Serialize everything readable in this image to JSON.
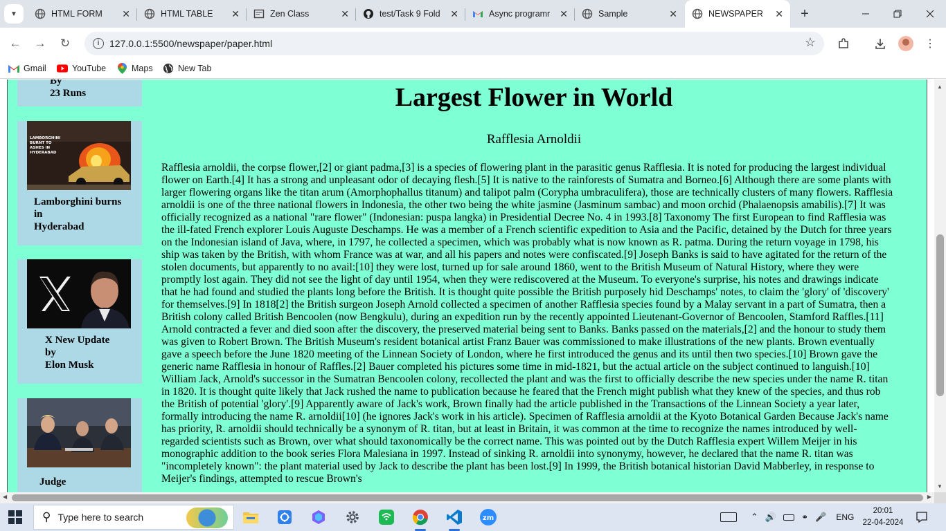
{
  "browser": {
    "tabs": [
      {
        "title": "HTML FORM",
        "icon": "globe-icon"
      },
      {
        "title": "HTML TABLE",
        "icon": "globe-icon"
      },
      {
        "title": "Zen Class",
        "icon": "zen-class-icon"
      },
      {
        "title": "test/Task 9 Fold",
        "icon": "github-icon"
      },
      {
        "title": "Async programr",
        "icon": "gmail-icon"
      },
      {
        "title": "Sample",
        "icon": "globe-icon"
      },
      {
        "title": "NEWSPAPER",
        "icon": "globe-icon",
        "active": true
      }
    ],
    "url": "127.0.0.1:5500/newspaper/paper.html",
    "bookmarks": [
      {
        "label": "Gmail",
        "icon": "gmail-icon"
      },
      {
        "label": "YouTube",
        "icon": "youtube-icon"
      },
      {
        "label": "Maps",
        "icon": "maps-icon"
      },
      {
        "label": "New Tab",
        "icon": "globe-icon"
      }
    ]
  },
  "page": {
    "sidebar": {
      "card0": {
        "line1": "By",
        "line2": "23 Runs"
      },
      "card1": {
        "line1": "Lamborghini burns",
        "line2": "in",
        "line3": "Hyderabad",
        "image_text": "LAMBORGHINI BURNT TO ASHES IN HYDERABAD"
      },
      "card2": {
        "line1": "X New Update",
        "line2": "by",
        "line3": "Elon Musk"
      },
      "card3": {
        "line1": "Judge"
      }
    },
    "headline": "Largest Flower in World",
    "subheadline": "Rafflesia Arnoldii",
    "body": "Rafflesia arnoldii, the corpse flower,[2] or giant padma,[3] is a species of flowering plant in the parasitic genus Rafflesia. It is noted for producing the largest individual flower on Earth.[4] It has a strong and unpleasant odor of decaying flesh.[5] It is native to the rainforests of Sumatra and Borneo.[6] Although there are some plants with larger flowering organs like the titan arum (Amorphophallus titanum) and talipot palm (Corypha umbraculifera), those are technically clusters of many flowers. Rafflesia arnoldii is one of the three national flowers in Indonesia, the other two being the white jasmine (Jasminum sambac) and moon orchid (Phalaenopsis amabilis).[7] It was officially recognized as a national \"rare flower\" (Indonesian: puspa langka) in Presidential Decree No. 4 in 1993.[8] Taxonomy The first European to find Rafflesia was the ill-fated French explorer Louis Auguste Deschamps. He was a member of a French scientific expedition to Asia and the Pacific, detained by the Dutch for three years on the Indonesian island of Java, where, in 1797, he collected a specimen, which was probably what is now known as R. patma. During the return voyage in 1798, his ship was taken by the British, with whom France was at war, and all his papers and notes were confiscated.[9] Joseph Banks is said to have agitated for the return of the stolen documents, but apparently to no avail:[10] they were lost, turned up for sale around 1860, went to the British Museum of Natural History, where they were promptly lost again. They did not see the light of day until 1954, when they were rediscovered at the Museum. To everyone's surprise, his notes and drawings indicate that he had found and studied the plants long before the British. It is thought quite possible the British purposely hid Deschamps' notes, to claim the 'glory' of 'discovery' for themselves.[9] In 1818[2] the British surgeon Joseph Arnold collected a specimen of another Rafflesia species found by a Malay servant in a part of Sumatra, then a British colony called British Bencoolen (now Bengkulu), during an expedition run by the recently appointed Lieutenant-Governor of Bencoolen, Stamford Raffles.[11] Arnold contracted a fever and died soon after the discovery, the preserved material being sent to Banks. Banks passed on the materials,[2] and the honour to study them was given to Robert Brown. The British Museum's resident botanical artist Franz Bauer was commissioned to make illustrations of the new plants. Brown eventually gave a speech before the June 1820 meeting of the Linnean Society of London, where he first introduced the genus and its until then two species.[10] Brown gave the generic name Rafflesia in honour of Raffles.[2] Bauer completed his pictures some time in mid-1821, but the actual article on the subject continued to languish.[10] William Jack, Arnold's successor in the Sumatran Bencoolen colony, recollected the plant and was the first to officially describe the new species under the name R. titan in 1820. It is thought quite likely that Jack rushed the name to publication because he feared that the French might publish what they knew of the species, and thus rob the British of potential 'glory'.[9] Apparently aware of Jack's work, Brown finally had the article published in the Transactions of the Linnean Society a year later, formally introducing the name R. arnoldii[10] (he ignores Jack's work in his article). Specimen of Rafflesia arnoldii at the Kyoto Botanical Garden Because Jack's name has priority, R. arnoldii should technically be a synonym of R. titan, but at least in Britain, it was common at the time to recognize the names introduced by well-regarded scientists such as Brown, over what should taxonomically be the correct name. This was pointed out by the Dutch Rafflesia expert Willem Meijer in his monographic addition to the book series Flora Malesiana in 1997. Instead of sinking R. arnoldii into synonymy, however, he declared that the name R. titan was \"incompletely known\": the plant material used by Jack to describe the plant has been lost.[9] In 1999, the British botanical historian David Mabberley, in response to Meijer's findings, attempted to rescue Brown's"
  },
  "taskbar": {
    "search_placeholder": "Type here to search",
    "apps": [
      "file-explorer-icon",
      "snipping-tool-icon",
      "copilot-icon",
      "settings-icon",
      "wifi-hotspot-icon",
      "chrome-icon",
      "vscode-icon",
      "zoom-icon"
    ],
    "language": "ENG",
    "time": "20:01",
    "date": "22-04-2024"
  },
  "colors": {
    "page_background": "#7fffd4",
    "card_background": "#add8e6",
    "tabstrip": "#dfe3ea",
    "taskbar": "#dde5f2"
  }
}
